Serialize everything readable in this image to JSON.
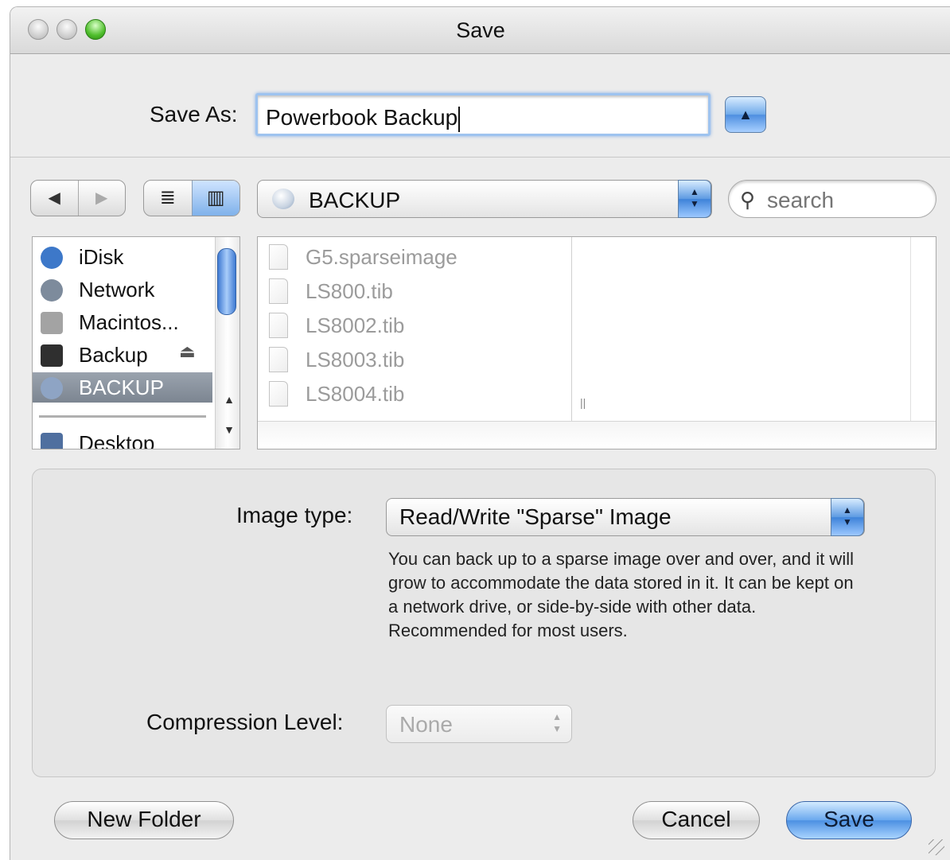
{
  "window": {
    "title": "Save"
  },
  "save_as": {
    "label": "Save As:",
    "value": "Powerbook Backup"
  },
  "toolbar": {
    "back_glyph": "◀",
    "forward_glyph": "▶",
    "list_view_glyph": "≣",
    "column_view_glyph": "▥",
    "location": "BACKUP",
    "search_placeholder": "search",
    "expand_glyph": "▲"
  },
  "sidebar": {
    "items": [
      {
        "label": "iDisk",
        "icon": "idisk-icon",
        "color": "#3d78c9"
      },
      {
        "label": "Network",
        "icon": "network-icon",
        "color": "#7d8b9c"
      },
      {
        "label": "Macintos...",
        "icon": "hard-drive-icon",
        "color": "#a3a3a3"
      },
      {
        "label": "Backup",
        "icon": "external-drive-icon",
        "color": "#2f2f2f"
      },
      {
        "label": "BACKUP",
        "icon": "disk-image-icon",
        "color": "#8ea4c4",
        "selected": true
      },
      {
        "label": "Desktop",
        "icon": "desktop-icon",
        "color": "#4f6f9f"
      }
    ],
    "eject_glyph": "⏏"
  },
  "files": [
    {
      "name": "G5.sparseimage"
    },
    {
      "name": "LS800.tib"
    },
    {
      "name": "LS8002.tib"
    },
    {
      "name": "LS8003.tib"
    },
    {
      "name": "LS8004.tib"
    }
  ],
  "options": {
    "image_type_label": "Image type:",
    "image_type_value": "Read/Write \"Sparse\" Image",
    "description": "You can back up to a sparse image over and over, and it will grow to accommodate the data stored in it. It can be kept on a network drive, or side-by-side with other data. Recommended for most users.",
    "compression_label": "Compression Level:",
    "compression_value": "None"
  },
  "buttons": {
    "new_folder": "New Folder",
    "cancel": "Cancel",
    "save": "Save"
  },
  "colors": {
    "accent": "#4c90e2",
    "selection": "#7c8591"
  }
}
